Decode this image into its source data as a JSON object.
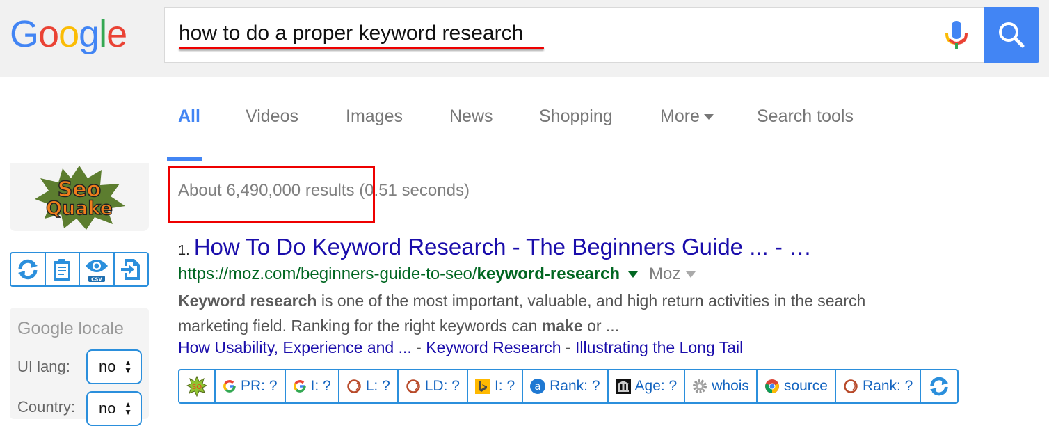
{
  "header": {
    "logo_letters": [
      {
        "ch": "G",
        "color": "#4285f4"
      },
      {
        "ch": "o",
        "color": "#ea4335"
      },
      {
        "ch": "o",
        "color": "#fbbc05"
      },
      {
        "ch": "g",
        "color": "#4285f4"
      },
      {
        "ch": "l",
        "color": "#34a853"
      },
      {
        "ch": "e",
        "color": "#ea4335"
      }
    ],
    "search_query": "how to do a proper keyword research",
    "mic_icon": "microphone-icon",
    "search_button_icon": "search-icon"
  },
  "tabs": [
    {
      "label": "All",
      "active": true
    },
    {
      "label": "Videos"
    },
    {
      "label": "Images"
    },
    {
      "label": "News"
    },
    {
      "label": "Shopping"
    },
    {
      "label": "More"
    },
    {
      "label": "Search tools"
    }
  ],
  "sidebar": {
    "logo_line1": "Seo",
    "logo_line2": "Quake",
    "toolbar": [
      {
        "icon": "refresh-icon"
      },
      {
        "icon": "clipboard-icon"
      },
      {
        "icon": "eye-csv-icon",
        "badge": "CSV"
      },
      {
        "icon": "export-file-icon"
      }
    ],
    "locale": {
      "title": "Google locale",
      "ui_lang_label": "UI lang:",
      "ui_lang_value": "no",
      "country_label": "Country:",
      "country_value": "no"
    }
  },
  "results_stats": {
    "count": "About 6,490,000 results",
    "time": "(0.51 seconds)"
  },
  "result": {
    "number": "1.",
    "title": "How To Do Keyword Research - The Beginners Guide ... - …",
    "url_plain": "https://moz.com/beginners-guide-to-seo/",
    "url_bold": "keyword-research",
    "site_name": "Moz",
    "snippet_bold1": "Keyword research",
    "snippet_text1": " is one of the most important, valuable, and high return activities in the search marketing field. Ranking for the right keywords can ",
    "snippet_bold2": "make",
    "snippet_text2": " or ...",
    "sitelinks": [
      "How Usability, Experience and ...",
      "Keyword Research",
      "Illustrating the Long Tail"
    ],
    "sitelink_separator": " - "
  },
  "seoquake_bar": [
    {
      "icon": "seoquake-icon",
      "label": ""
    },
    {
      "icon": "google-icon",
      "label": "PR: ?"
    },
    {
      "icon": "google-icon",
      "label": "I: ?"
    },
    {
      "icon": "semrush-icon",
      "label": "L: ?"
    },
    {
      "icon": "semrush-icon",
      "label": "LD: ?"
    },
    {
      "icon": "bing-icon",
      "label": "I: ?"
    },
    {
      "icon": "alexa-icon",
      "label": "Rank: ?"
    },
    {
      "icon": "archive-icon",
      "label": "Age: ?"
    },
    {
      "icon": "gear-icon",
      "label": "whois"
    },
    {
      "icon": "chrome-icon",
      "label": "source"
    },
    {
      "icon": "semrush-icon",
      "label": "Rank: ?"
    },
    {
      "icon": "refresh-icon",
      "label": ""
    }
  ]
}
